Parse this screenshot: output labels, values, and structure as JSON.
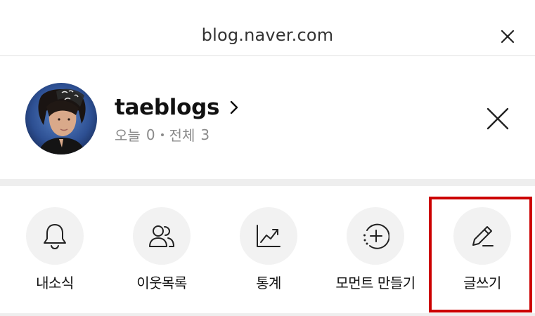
{
  "header": {
    "url": "blog.naver.com"
  },
  "profile": {
    "blog_name": "taeblogs",
    "stats": {
      "today_label": "오늘",
      "today_count": "0",
      "total_label": "전체",
      "total_count": "3"
    }
  },
  "actions": [
    {
      "label": "내소식",
      "icon": "bell-icon"
    },
    {
      "label": "이웃목록",
      "icon": "people-icon"
    },
    {
      "label": "통계",
      "icon": "trending-chart-icon"
    },
    {
      "label": "모먼트 만들기",
      "icon": "add-moment-icon"
    },
    {
      "label": "글쓰기",
      "icon": "pencil-icon"
    }
  ],
  "colors": {
    "highlight_border": "#cc0000",
    "icon_circle_bg": "#f2f2f2",
    "muted_text": "#8a8a8a"
  }
}
